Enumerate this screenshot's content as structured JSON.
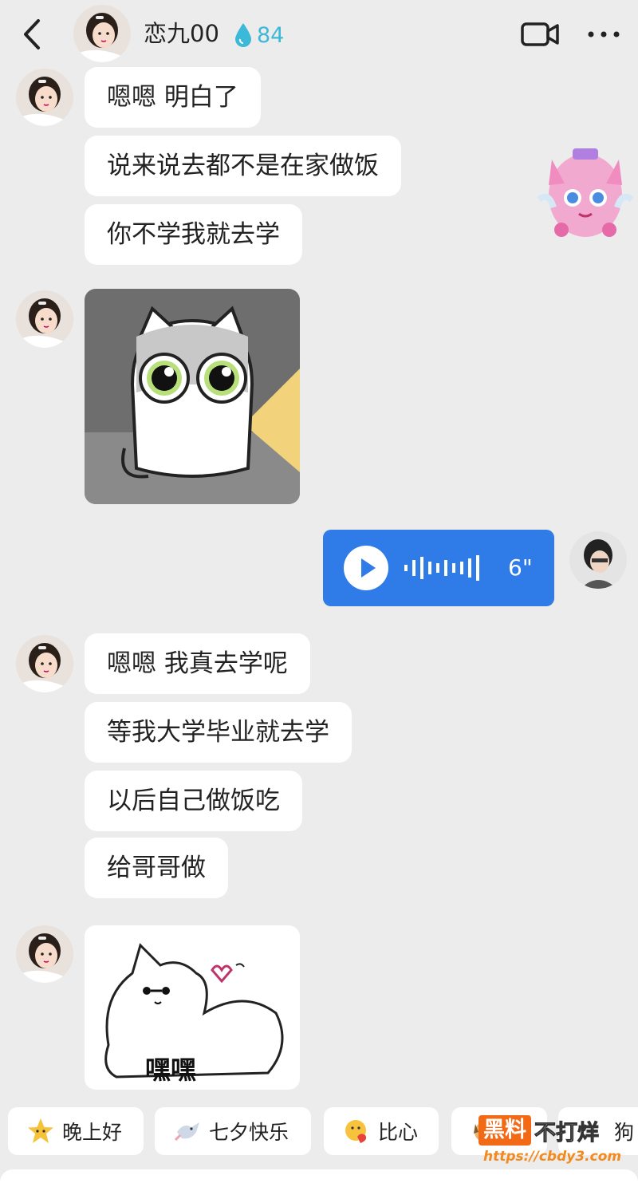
{
  "header": {
    "title": "恋九00",
    "intimacy": "84",
    "back_icon": "chevron-left-icon",
    "video_icon": "video-camera-icon",
    "more_icon": "more-dots-icon"
  },
  "messages": [
    {
      "type": "text",
      "text": "嗯嗯 明白了"
    },
    {
      "type": "text",
      "text": "说来说去都不是在家做饭"
    },
    {
      "type": "text",
      "text": "你不学我就去学"
    },
    {
      "type": "sticker",
      "name": "crying-cat-sticker"
    },
    {
      "type": "voice",
      "duration": "6\""
    },
    {
      "type": "text",
      "text": "嗯嗯 我真去学呢"
    },
    {
      "type": "text",
      "text": "等我大学毕业就去学"
    },
    {
      "type": "text",
      "text": "以后自己做饭吃"
    },
    {
      "type": "text",
      "text": "给哥哥做"
    },
    {
      "type": "sticker",
      "name": "fluffy-cat-sticker",
      "caption": "嘿嘿"
    }
  ],
  "quick_replies": [
    {
      "label": "晚上好",
      "icon": "star-icon"
    },
    {
      "label": "七夕快乐",
      "icon": "magpie-icon"
    },
    {
      "label": "比心",
      "icon": "heart-hand-icon"
    },
    {
      "label": "狗",
      "icon": "dog-icon"
    }
  ],
  "watermark": {
    "brand": "黑料",
    "tagline": "不打烊",
    "url": "https://cbdy3.com"
  },
  "colors": {
    "background": "#ececec",
    "bubble": "#ffffff",
    "voice_bubble": "#2f7be8",
    "intimacy": "#3cb8d8"
  }
}
